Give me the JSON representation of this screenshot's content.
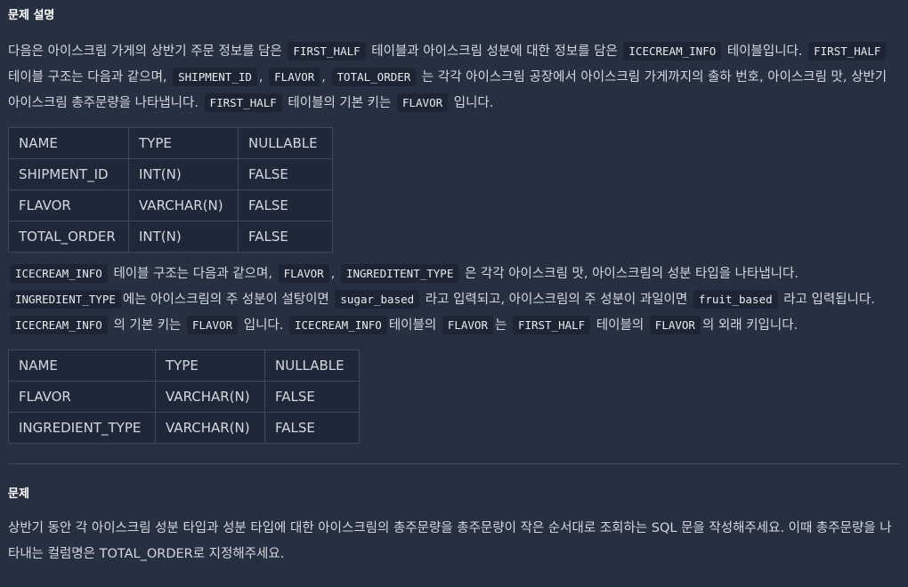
{
  "description": {
    "title": "문제 설명",
    "p1": {
      "t1": "다음은 아이스크림 가게의 상반기 주문 정보를 담은",
      "c1": "FIRST_HALF",
      "t2": "테이블과 아이스크림 성분에 대한 정보를 담은",
      "c2": "ICECREAM_INFO",
      "t3": "테이블입니다.",
      "c3": "FIRST_HALF",
      "t4": "테이블 구조는 다음과 같으며,",
      "c4": "SHIPMENT_ID",
      "t5": ",",
      "c5": "FLAVOR",
      "t6": ",",
      "c6": "TOTAL_ORDER",
      "t7": "는 각각 아이스크림 공장에서 아이스크림 가게까지의 출하 번호, 아이스크림 맛, 상반기 아이스크림 총주문량을 나타냅니다.",
      "c7": "FIRST_HALF",
      "t8": "테이블의 기본 키는",
      "c8": "FLAVOR",
      "t9": "입니다."
    },
    "table1": {
      "headers": [
        "NAME",
        "TYPE",
        "NULLABLE"
      ],
      "rows": [
        [
          "SHIPMENT_ID",
          "INT(N)",
          "FALSE"
        ],
        [
          "FLAVOR",
          "VARCHAR(N)",
          "FALSE"
        ],
        [
          "TOTAL_ORDER",
          "INT(N)",
          "FALSE"
        ]
      ]
    },
    "p2": {
      "c1": "ICECREAM_INFO",
      "t1": "테이블 구조는 다음과 같으며,",
      "c2": "FLAVOR",
      "t2": ",",
      "c3": "INGREDITENT_TYPE",
      "t3": "은 각각 아이스크림 맛, 아이스크림의 성분 타입을 나타냅니다.",
      "c4": "INGREDIENT_TYPE",
      "t4": "에는 아이스크림의 주 성분이 설탕이면",
      "c5": "sugar_based",
      "t5": "라고 입력되고, 아이스크림의 주 성분이 과일이면",
      "c6": "fruit_based",
      "t6": "라고 입력됩니다.",
      "c7": "ICECREAM_INFO",
      "t7": "의 기본 키는",
      "c8": "FLAVOR",
      "t8": "입니다.",
      "c9": "ICECREAM_INFO",
      "t9": "테이블의",
      "c10": "FLAVOR",
      "t10": "는",
      "c11": "FIRST_HALF",
      "t11": "테이블의",
      "c12": "FLAVOR",
      "t12": "의 외래 키입니다."
    },
    "table2": {
      "headers": [
        "NAME",
        "TYPE",
        "NULLABLE"
      ],
      "rows": [
        [
          "FLAVOR",
          "VARCHAR(N)",
          "FALSE"
        ],
        [
          "INGREDIENT_TYPE",
          "VARCHAR(N)",
          "FALSE"
        ]
      ]
    }
  },
  "problem": {
    "title": "문제",
    "text": "상반기 동안 각 아이스크림 성분 타입과 성분 타입에 대한 아이스크림의 총주문량을 총주문량이 작은 순서대로 조회하는 SQL 문을 작성해주세요. 이때 총주문량을 나타내는 컬럼명은 TOTAL_ORDER로 지정해주세요."
  }
}
